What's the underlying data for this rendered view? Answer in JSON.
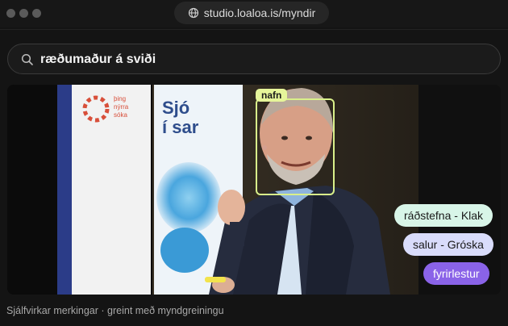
{
  "browser": {
    "url": "studio.loaloa.is/myndir"
  },
  "search": {
    "query": "ræðumaður á sviði"
  },
  "photo": {
    "face_label": "nafn",
    "tags": [
      "ráðstefna - Klak",
      "salur - Gróska",
      "fyrirlestur"
    ],
    "banner_text_left": [
      "frá",
      "til",
      "sk",
      "v",
      "iða"
    ],
    "banner_text_right": [
      "Sjó",
      "í sar"
    ]
  },
  "caption": "Sjálfvirkar merkingar · greint með myndgreiningu",
  "colors": {
    "face_box": "#d9f08a",
    "tag_1": "#d8f5e8",
    "tag_2": "#d9dcfb",
    "tag_3": "#8a63e8"
  }
}
